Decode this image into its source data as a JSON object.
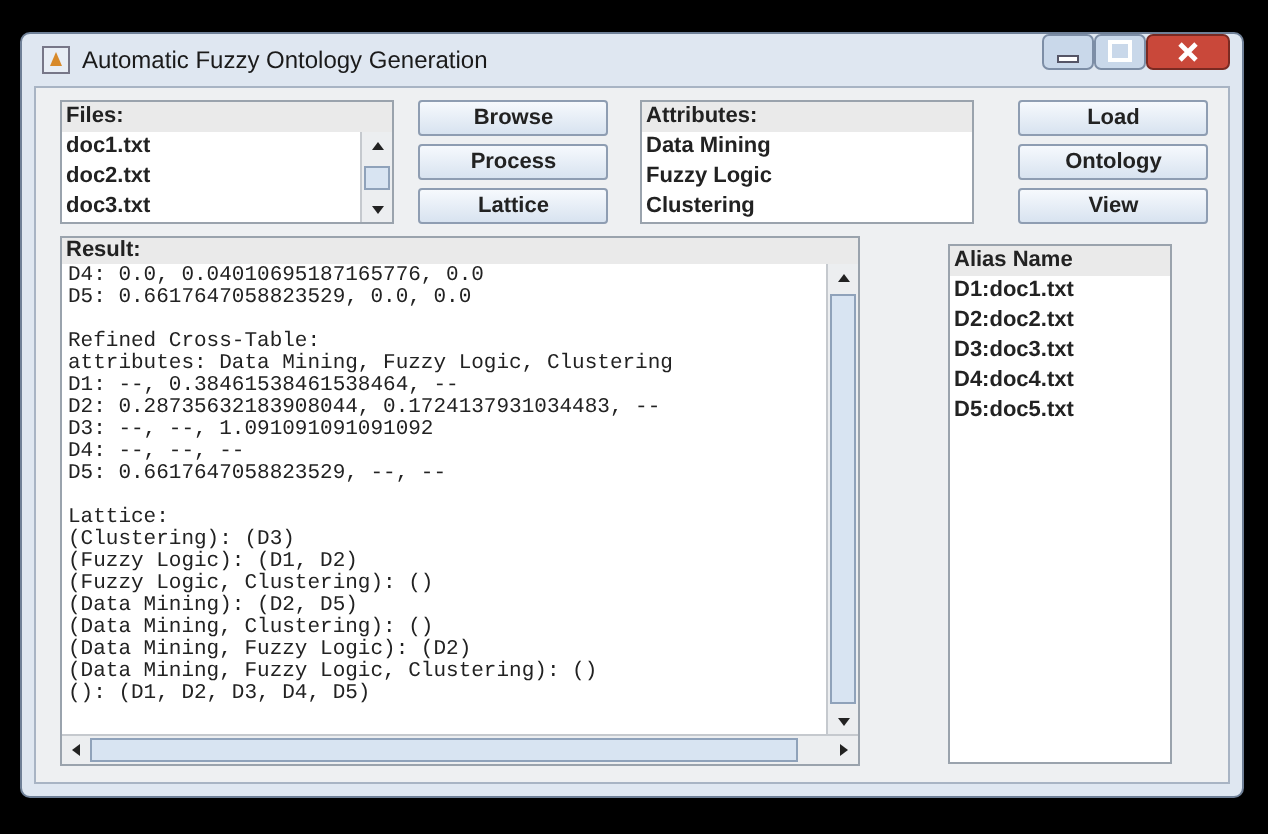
{
  "window": {
    "title": "Automatic Fuzzy Ontology Generation"
  },
  "files": {
    "label": "Files:",
    "items": [
      "doc1.txt",
      "doc2.txt",
      "doc3.txt"
    ]
  },
  "file_buttons": [
    "Browse",
    "Process",
    "Lattice"
  ],
  "attributes": {
    "label": "Attributes:",
    "items": [
      "Data Mining",
      "Fuzzy Logic",
      "Clustering"
    ]
  },
  "attribute_buttons": [
    "Load",
    "Ontology",
    "View"
  ],
  "result": {
    "label": "Result:",
    "blocks": [
      [
        "D4: 0.0, 0.04010695187165776, 0.0",
        "D5: 0.6617647058823529, 0.0, 0.0"
      ],
      [
        "Refined Cross-Table:",
        "attributes: Data Mining, Fuzzy Logic, Clustering",
        "D1: --, 0.38461538461538464, --",
        "D2: 0.28735632183908044, 0.1724137931034483, --",
        "D3: --, --, 1.091091091091092",
        "D4: --, --, --",
        "D5: 0.6617647058823529, --, --"
      ],
      [
        "Lattice:",
        "(Clustering): (D3)",
        "(Fuzzy Logic): (D1, D2)",
        "(Fuzzy Logic, Clustering): ()",
        "(Data Mining): (D2, D5)",
        "(Data Mining, Clustering): ()",
        "(Data Mining, Fuzzy Logic): (D2)",
        "(Data Mining, Fuzzy Logic, Clustering): ()",
        "(): (D1, D2, D3, D4, D5)"
      ]
    ]
  },
  "alias": {
    "label": "Alias Name",
    "items": [
      "D1:doc1.txt",
      "D2:doc2.txt",
      "D3:doc3.txt",
      "D4:doc4.txt",
      "D5:doc5.txt"
    ]
  }
}
